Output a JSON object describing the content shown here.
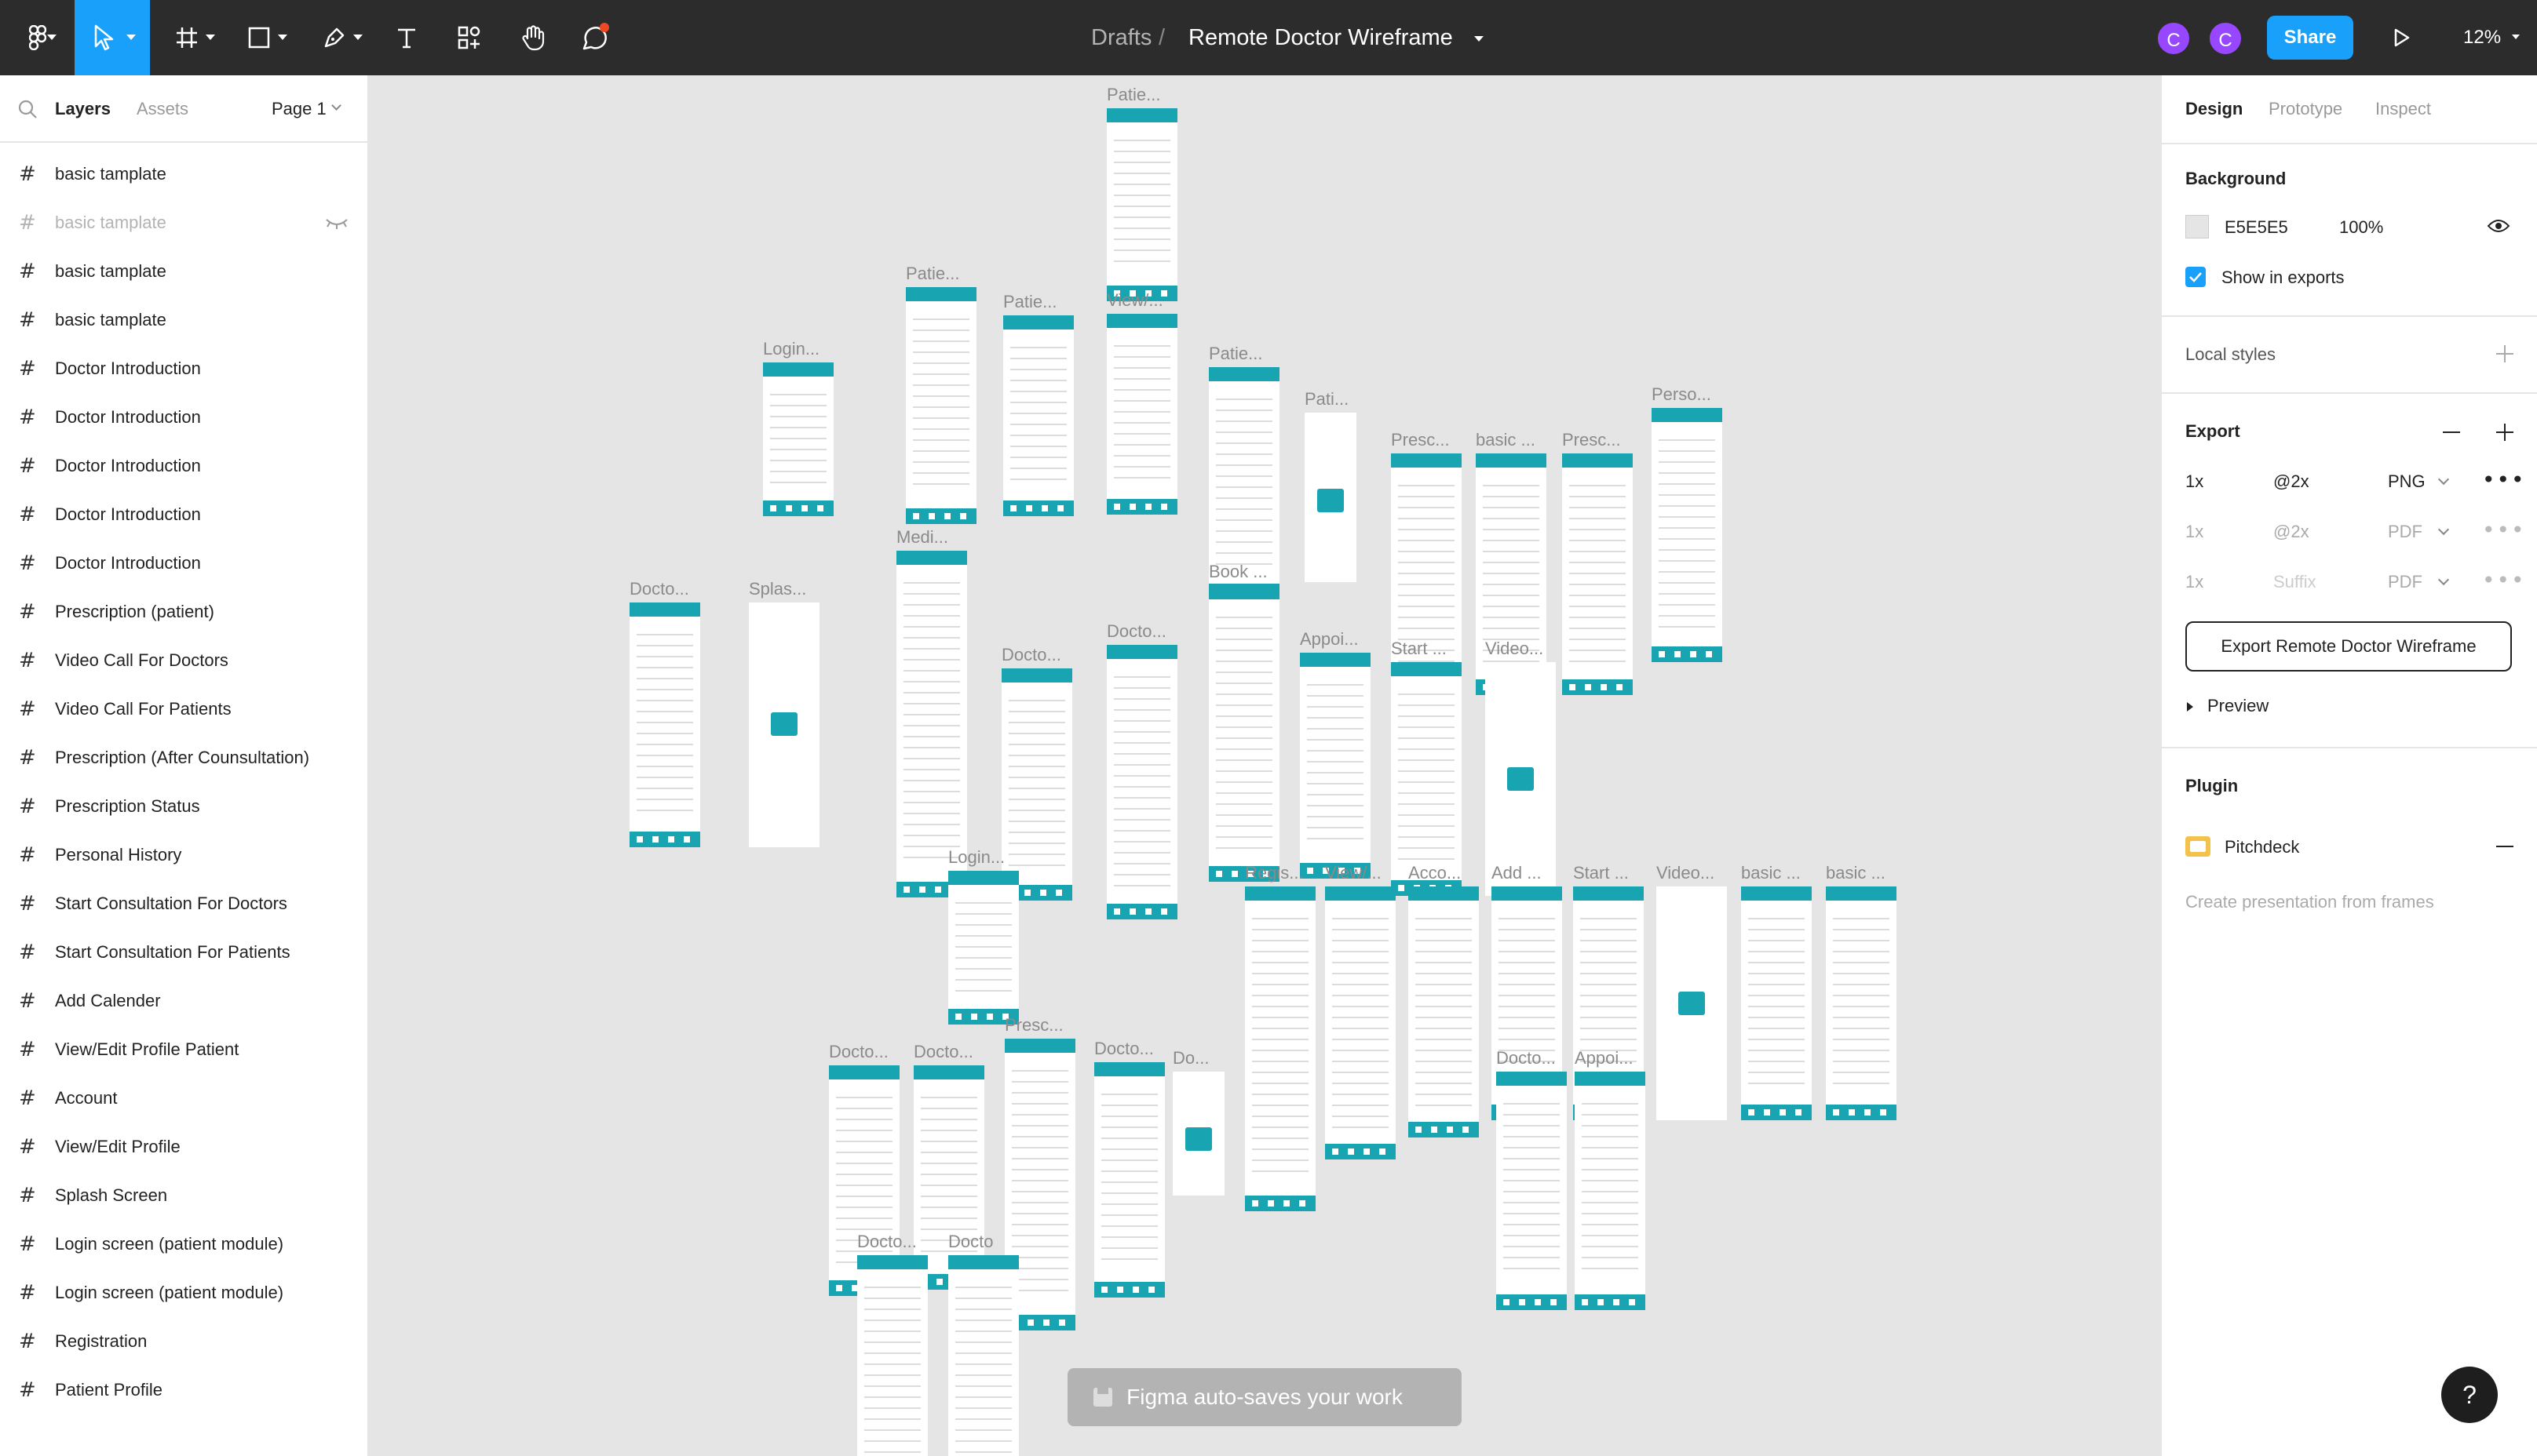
{
  "toolbar": {
    "breadcrumb_parent": "Drafts",
    "breadcrumb_sep": "/",
    "file_name": "Remote Doctor Wireframe",
    "avatar_1": "C",
    "avatar_2": "C",
    "share_label": "Share",
    "zoom": "12%",
    "colors": {
      "accent": "#18a0fb",
      "avatar": "#9747ff"
    }
  },
  "left_panel": {
    "tabs": [
      "Layers",
      "Assets"
    ],
    "page": "Page 1",
    "layers": [
      {
        "name": "basic tamplate",
        "hidden": false
      },
      {
        "name": "basic tamplate",
        "hidden": true
      },
      {
        "name": "basic tamplate",
        "hidden": false
      },
      {
        "name": "basic tamplate",
        "hidden": false
      },
      {
        "name": "Doctor Introduction",
        "hidden": false
      },
      {
        "name": "Doctor Introduction",
        "hidden": false
      },
      {
        "name": "Doctor Introduction",
        "hidden": false
      },
      {
        "name": "Doctor Introduction",
        "hidden": false
      },
      {
        "name": "Doctor Introduction",
        "hidden": false
      },
      {
        "name": "Prescription (patient)",
        "hidden": false
      },
      {
        "name": "Video Call For Doctors",
        "hidden": false
      },
      {
        "name": "Video Call For Patients",
        "hidden": false
      },
      {
        "name": "Prescription (After Counsultation)",
        "hidden": false
      },
      {
        "name": "Prescription Status",
        "hidden": false
      },
      {
        "name": "Personal History",
        "hidden": false
      },
      {
        "name": "Start Consultation For Doctors",
        "hidden": false
      },
      {
        "name": "Start Consultation For Patients",
        "hidden": false
      },
      {
        "name": "Add Calender",
        "hidden": false
      },
      {
        "name": "View/Edit Profile Patient",
        "hidden": false
      },
      {
        "name": "Account",
        "hidden": false
      },
      {
        "name": "View/Edit Profile",
        "hidden": false
      },
      {
        "name": "Splash Screen",
        "hidden": false
      },
      {
        "name": "Login screen (patient module)",
        "hidden": false
      },
      {
        "name": "Login screen (patient module)",
        "hidden": false
      },
      {
        "name": "Registration",
        "hidden": false
      },
      {
        "name": "Patient Profile",
        "hidden": false
      }
    ]
  },
  "right_panel": {
    "tabs": [
      "Design",
      "Prototype",
      "Inspect"
    ],
    "background": {
      "title": "Background",
      "hex": "E5E5E5",
      "opacity": "100%",
      "show_in_exports": "Show in exports"
    },
    "local_styles": "Local styles",
    "export": {
      "title": "Export",
      "rows": [
        {
          "scale": "1x",
          "suffix": "@2x",
          "format": "PNG",
          "muted": false
        },
        {
          "scale": "1x",
          "suffix": "@2x",
          "format": "PDF",
          "muted": true
        },
        {
          "scale": "1x",
          "suffix": "Suffix",
          "format": "PDF",
          "muted": true
        }
      ],
      "button": "Export Remote Doctor Wireframe",
      "preview": "Preview"
    },
    "plugin": {
      "title": "Plugin",
      "name": "Pitchdeck",
      "hint": "Create presentation from frames"
    }
  },
  "canvas": {
    "frame_labels": [
      "Patie...",
      "Patie...",
      "Patie...",
      "View/...",
      "Login...",
      "Patie...",
      "Pati...",
      "Presc...",
      "Perso...",
      "Presc...",
      "basic ...",
      "Docto...",
      "Splas...",
      "Medi...",
      "Docto...",
      "Docto...",
      "Book ...",
      "Appoi...",
      "Start ...",
      "Video...",
      "Login...",
      "Regis...",
      "View/...",
      "Acco...",
      "Add ...",
      "Start ...",
      "Video...",
      "basic ...",
      "basic ...",
      "Docto...",
      "Docto...",
      "Presc...",
      "Docto...",
      "Do...",
      "Docto...",
      "Appoi...",
      "Docto...",
      "Docto"
    ]
  },
  "toast": "Figma auto-saves your work",
  "help": "?"
}
